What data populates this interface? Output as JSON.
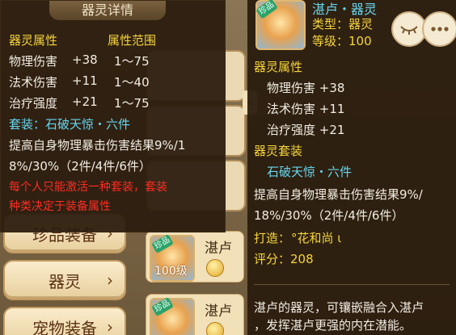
{
  "left_tooltip": {
    "title": "器灵详情",
    "header_attr": "器灵属性",
    "header_range": "属性范围",
    "stats": [
      {
        "name": "物理伤害",
        "value": "+38",
        "range": "1～75"
      },
      {
        "name": "法术伤害",
        "value": "+11",
        "range": "1～40"
      },
      {
        "name": "治疗强度",
        "value": "+21",
        "range": "1～75"
      }
    ],
    "set_label": "套装：石破天惊・六件",
    "set_desc_line1": "提高自身物理暴击伤害结果9%/1",
    "set_desc_line2": "8%/30%（2件/4件/6件）",
    "warn_line1": "每个人只能激活一种套装，套装",
    "warn_line2": "种类决定于装备属性"
  },
  "right_tooltip": {
    "name": "湛卢・器灵",
    "type_label": "类型：器灵",
    "level_label": "等级：100",
    "tag": "珍品",
    "attr_header": "器灵属性",
    "stats": [
      "物理伤害 +38",
      "法术伤害 +11",
      "治疗强度 +21"
    ],
    "set_header": "器灵套装",
    "set_name": "石破天惊・六件",
    "set_desc_line1": "提高自身物理暴击伤害结果9%/",
    "set_desc_line2": "18%/30%（2件/4件/6件）",
    "forge_label": "打造：",
    "forge_value": "°花和尚 ι",
    "score_label": "评分：208",
    "desc_line1": "湛卢的器灵，可镶嵌融合入湛卢",
    "desc_line2": "，发挥湛卢更强的内在潜能。",
    "eye_icon": "eye-icon",
    "more_icon": "more-icon"
  },
  "categories": [
    {
      "label": "珍品装备",
      "chevron": "›"
    },
    {
      "label": "器灵",
      "chevron": "›"
    },
    {
      "label": "宠物装备",
      "chevron": "›"
    }
  ],
  "items": [
    {
      "tag": "珍品",
      "name": "湛卢",
      "level": "100级"
    },
    {
      "tag": "珍品",
      "name": "湛卢",
      "level": ""
    }
  ],
  "colors": {
    "yellow": "#f5d43a",
    "cyan": "#67d6f0",
    "red": "#ff2c22",
    "white": "#f2ede2"
  }
}
